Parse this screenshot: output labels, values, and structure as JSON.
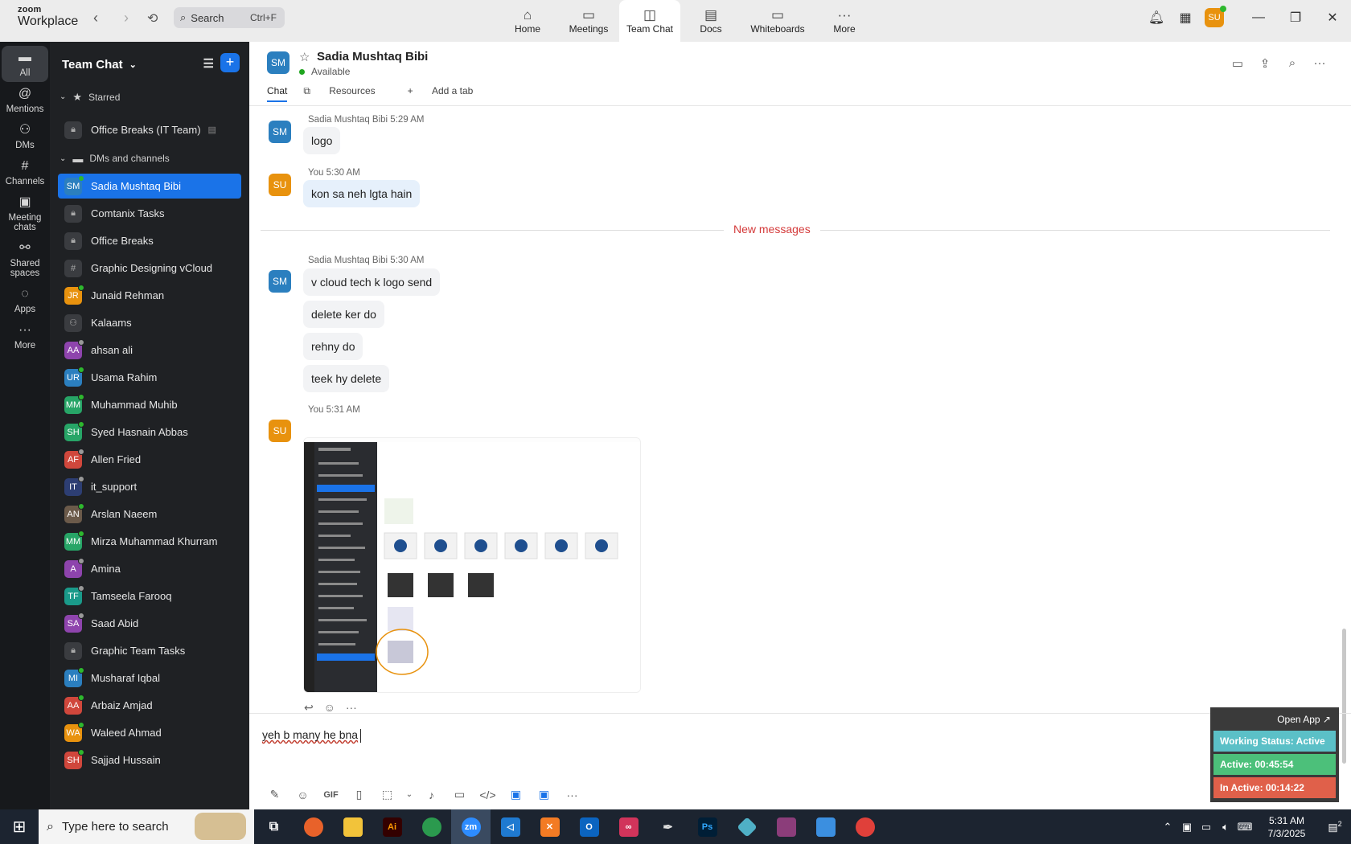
{
  "topbar": {
    "brand_top": "zoom",
    "brand_bottom": "Workplace",
    "search_placeholder": "Search",
    "search_shortcut": "Ctrl+F",
    "tabs": [
      {
        "label": "Home",
        "icon": "home-icon"
      },
      {
        "label": "Meetings",
        "icon": "video-icon"
      },
      {
        "label": "Team Chat",
        "icon": "chat-icon",
        "active": true
      },
      {
        "label": "Docs",
        "icon": "doc-icon"
      },
      {
        "label": "Whiteboards",
        "icon": "whiteboard-icon"
      },
      {
        "label": "More",
        "icon": "more-icon"
      }
    ],
    "user_initials": "SU"
  },
  "rail": [
    {
      "label": "All",
      "icon": "chat-bubble-icon",
      "active": true
    },
    {
      "label": "Mentions",
      "icon": "at-icon"
    },
    {
      "label": "DMs",
      "icon": "people-icon"
    },
    {
      "label": "Channels",
      "icon": "hash-icon"
    },
    {
      "label": "Meeting chats",
      "icon": "calendar-icon"
    },
    {
      "label": "Shared spaces",
      "icon": "share-icon"
    },
    {
      "label": "Apps",
      "icon": "apps-icon"
    },
    {
      "label": "More",
      "icon": "more-icon"
    }
  ],
  "sidebar": {
    "title": "Team Chat",
    "starred_label": "Starred",
    "dms_label": "DMs and channels",
    "starred_items": [
      {
        "label": "Office Breaks (IT Team)",
        "type": "lock"
      }
    ],
    "items": [
      {
        "label": "Sadia Mushtaq Bibi",
        "initials": "SM",
        "color": "#2b7fbf",
        "status": "#2eb82e",
        "selected": true
      },
      {
        "label": "Comtanix Tasks",
        "type": "lock"
      },
      {
        "label": "Office Breaks",
        "type": "lock"
      },
      {
        "label": "Graphic Designing vCloud",
        "type": "hash"
      },
      {
        "label": "Junaid Rehman",
        "initials": "JR",
        "color": "#e8920e",
        "status": "#2eb82e"
      },
      {
        "label": "Kalaams",
        "type": "group"
      },
      {
        "label": "ahsan ali",
        "initials": "AA",
        "color": "#8e44ad",
        "status": "#999999"
      },
      {
        "label": "Usama Rahim",
        "initials": "UR",
        "color": "#2b7fbf",
        "status": "#2eb82e"
      },
      {
        "label": "Muhammad Muhib",
        "initials": "MM",
        "color": "#27a567",
        "status": "#2eb82e"
      },
      {
        "label": "Syed Hasnain Abbas",
        "initials": "SH",
        "color": "#27a567",
        "status": "#2eb82e"
      },
      {
        "label": "Allen Fried",
        "initials": "AF",
        "color": "#d0473c",
        "status": "#999999"
      },
      {
        "label": "it_support",
        "initials": "IT",
        "color": "#2d3e73",
        "status": "#999999"
      },
      {
        "label": "Arslan Naeem",
        "initials": "AN",
        "color": "#6b5a4a",
        "status": "#2eb82e"
      },
      {
        "label": "Mirza Muhammad Khurram",
        "initials": "MM",
        "color": "#27a567",
        "status": "#2eb82e"
      },
      {
        "label": "Amina",
        "initials": "A",
        "color": "#8e44ad",
        "status": "#999999"
      },
      {
        "label": "Tamseela Farooq",
        "initials": "TF",
        "color": "#1a9a8a",
        "status": "#999999"
      },
      {
        "label": "Saad Abid",
        "initials": "SA",
        "color": "#8e44ad",
        "status": "#999999"
      },
      {
        "label": "Graphic Team Tasks",
        "type": "lock"
      },
      {
        "label": "Musharaf Iqbal",
        "initials": "MI",
        "color": "#2b7fbf",
        "status": "#2eb82e"
      },
      {
        "label": "Arbaiz Amjad",
        "initials": "AA",
        "color": "#d0473c",
        "status": "#2eb82e"
      },
      {
        "label": "Waleed Ahmad",
        "initials": "WA",
        "color": "#e8920e",
        "status": "#2eb82e"
      },
      {
        "label": "Sajjad Hussain",
        "initials": "SH",
        "color": "#d0473c",
        "status": "#2eb82e"
      }
    ]
  },
  "chat": {
    "contact_name": "Sadia Mushtaq Bibi",
    "contact_initials": "SM",
    "status": "Available",
    "tabs": [
      "Chat",
      "Resources",
      "Add a tab"
    ],
    "new_messages_label": "New messages",
    "messages": [
      {
        "sender": "Sadia Mushtaq Bibi",
        "time": "5:29 AM",
        "text": "logo"
      },
      {
        "sender": "You",
        "time": "5:30 AM",
        "text": "kon sa neh lgta hain"
      },
      {
        "sender": "Sadia Mushtaq Bibi",
        "time": "5:30 AM",
        "text": "v cloud tech k logo send"
      },
      {
        "text": "delete ker do"
      },
      {
        "text": "rehny do"
      },
      {
        "text": "teek hy delete"
      },
      {
        "sender": "You",
        "time": "5:31 AM",
        "attachment": "screenshot-image"
      }
    ],
    "composer_text": "yeh b many he bna"
  },
  "widget": {
    "open_label": "Open App ↗",
    "working_status": "Working Status: Active",
    "active": "Active: 00:45:54",
    "inactive": "In Active: 00:14:22",
    "colors": {
      "status": "#5bc0c7",
      "active": "#4cc07a",
      "inactive": "#e0604a"
    }
  },
  "taskbar": {
    "search_placeholder": "Type here to search",
    "time": "5:31 AM",
    "date": "7/3/2025",
    "notif_count": "2"
  }
}
